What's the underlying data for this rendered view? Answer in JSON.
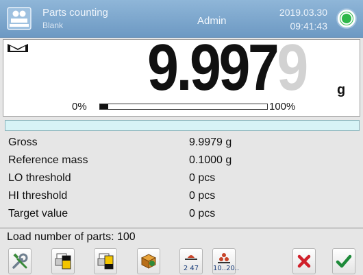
{
  "header": {
    "mode": "Parts counting",
    "sub_label": "Blank",
    "user": "Admin",
    "date": "2019.03.30",
    "time": "09:41:43"
  },
  "display": {
    "value_main": "9.997",
    "value_extra": "9",
    "unit": "g",
    "bar_min_label": "0%",
    "bar_max_label": "100%",
    "bar_fill_fraction": 0.05
  },
  "info": [
    {
      "label": "Gross",
      "value": "9.9979 g"
    },
    {
      "label": "Reference mass",
      "value": "0.1000 g"
    },
    {
      "label": "LO threshold",
      "value": "0 pcs"
    },
    {
      "label": "HI threshold",
      "value": "0 pcs"
    },
    {
      "label": "Target value",
      "value": "0 pcs"
    }
  ],
  "footer": {
    "load_text": "Load number of parts: 100"
  },
  "toolbar": {
    "count_caption": "2 47",
    "sample_caption": "10..20..",
    "buttons": [
      {
        "icon": "settings-tools-icon"
      },
      {
        "icon": "printer-header-icon"
      },
      {
        "icon": "printer-footer-icon"
      },
      {
        "icon": "database-product-icon"
      },
      {
        "icon": "reference-mass-icon"
      },
      {
        "icon": "sample-quantity-icon"
      },
      {
        "icon": "cancel-icon"
      },
      {
        "icon": "confirm-icon"
      }
    ]
  },
  "colors": {
    "header_bg": "#7aa5cd",
    "status_green": "#2fb84a",
    "strip_bg": "#d7f3f6",
    "cancel_red": "#d0202a",
    "confirm_green": "#1e8a3a"
  }
}
